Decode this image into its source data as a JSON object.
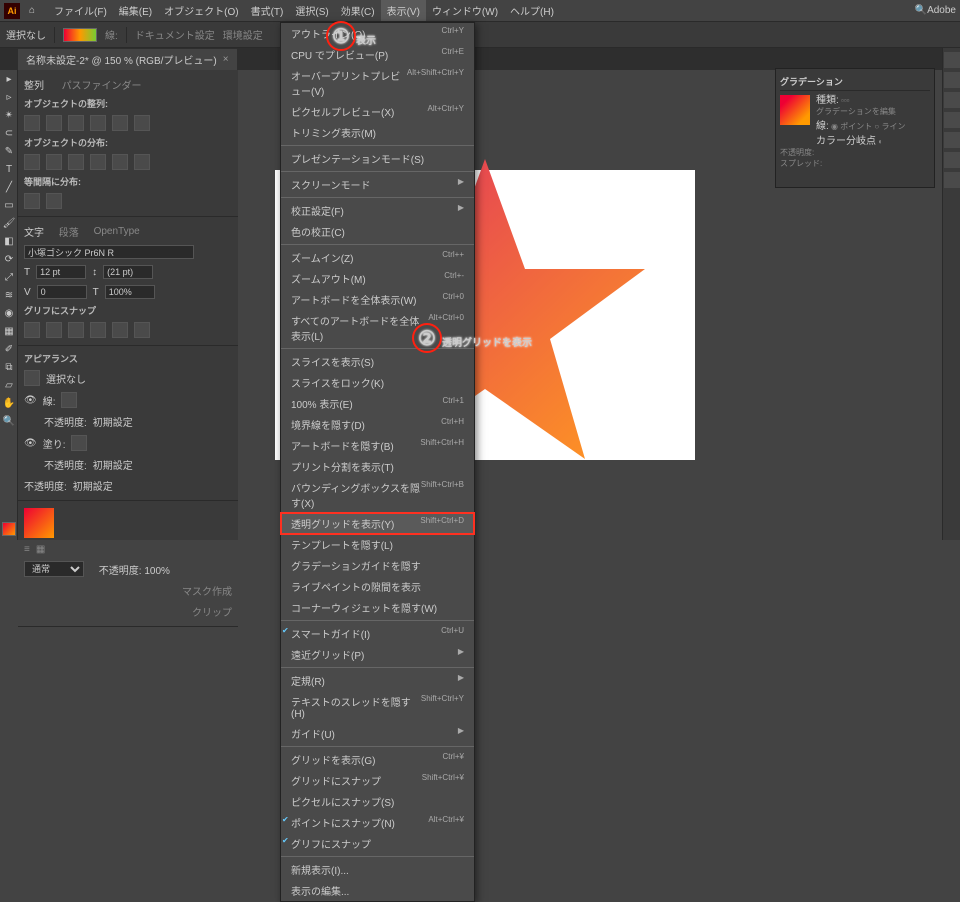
{
  "menubar": {
    "items": [
      "ファイル(F)",
      "編集(E)",
      "オブジェクト(O)",
      "書式(T)",
      "選択(S)",
      "効果(C)",
      "表示(V)",
      "ウィンドウ(W)",
      "ヘルプ(H)"
    ],
    "active_index": 6,
    "search_placeholder": "Adobe"
  },
  "ctrlbar": {
    "sel": "選択なし",
    "stroke": "線:",
    "doc_setup": "ドキュメント設定",
    "pref": "環境設定"
  },
  "doctab": {
    "title": "名称未設定-2* @ 150 % (RGB/プレビュー)",
    "close": "×"
  },
  "left": {
    "tabs": [
      "整列",
      "パスファインダー"
    ],
    "h_align": "オブジェクトの整列:",
    "h_dist": "オブジェクトの分布:",
    "h_spacing": "等間隔に分布:",
    "char_tabs": [
      "文字",
      "段落",
      "OpenType"
    ],
    "font": "小塚ゴシック Pr6N R",
    "size": "12 pt",
    "leading": "(21 pt)",
    "tracking": "0",
    "kerning": "100%",
    "vscale": "100%",
    "gsnap": "グリフにスナップ",
    "appear": "アピアランス",
    "nosel": "選択なし",
    "stroke": "線:",
    "fill": "塗り:",
    "opacity_lbl": "不透明度:",
    "opacity_val": "初期設定",
    "mode": "通常",
    "op100": "不透明度: 100%",
    "mask": "マスク作成",
    "clip": "クリップ"
  },
  "grad": {
    "title": "グラデーション",
    "type": "種類:",
    "edit": "グラデーションを編集",
    "stroke": "線:",
    "angle": "カラー分岐点",
    "op": "不透明度:",
    "spread": "スプレッド:"
  },
  "view_menu": [
    {
      "l": "アウトライン(O)",
      "s": "Ctrl+Y"
    },
    {
      "l": "CPU でプレビュー(P)",
      "s": "Ctrl+E"
    },
    {
      "l": "オーバープリントプレビュー(V)",
      "s": "Alt+Shift+Ctrl+Y"
    },
    {
      "l": "ピクセルプレビュー(X)",
      "s": "Alt+Ctrl+Y"
    },
    {
      "l": "トリミング表示(M)",
      "s": ""
    },
    {
      "hr": true
    },
    {
      "l": "プレゼンテーションモード(S)",
      "s": ""
    },
    {
      "hr": true
    },
    {
      "l": "スクリーンモード",
      "s": "",
      "sub": true
    },
    {
      "hr": true
    },
    {
      "l": "校正設定(F)",
      "s": "",
      "sub": true
    },
    {
      "l": "色の校正(C)",
      "s": ""
    },
    {
      "hr": true
    },
    {
      "l": "ズームイン(Z)",
      "s": "Ctrl++"
    },
    {
      "l": "ズームアウト(M)",
      "s": "Ctrl+-"
    },
    {
      "l": "アートボードを全体表示(W)",
      "s": "Ctrl+0"
    },
    {
      "l": "すべてのアートボードを全体表示(L)",
      "s": "Alt+Ctrl+0"
    },
    {
      "hr": true
    },
    {
      "l": "スライスを表示(S)",
      "s": ""
    },
    {
      "l": "スライスをロック(K)",
      "s": ""
    },
    {
      "l": "100% 表示(E)",
      "s": "Ctrl+1"
    },
    {
      "l": "境界線を隠す(D)",
      "s": "Ctrl+H"
    },
    {
      "l": "アートボードを隠す(B)",
      "s": "Shift+Ctrl+H"
    },
    {
      "l": "プリント分割を表示(T)",
      "s": ""
    },
    {
      "l": "バウンディングボックスを隠す(X)",
      "s": "Shift+Ctrl+B"
    },
    {
      "l": "透明グリッドを表示(Y)",
      "s": "Shift+Ctrl+D",
      "hl": true
    },
    {
      "l": "テンプレートを隠す(L)",
      "s": "",
      "dis": true
    },
    {
      "l": "グラデーションガイドを隠す",
      "s": "",
      "dis": true
    },
    {
      "l": "ライブペイントの隙間を表示",
      "s": "",
      "dis": true
    },
    {
      "l": "コーナーウィジェットを隠す(W)",
      "s": ""
    },
    {
      "hr": true
    },
    {
      "l": "スマートガイド(I)",
      "s": "Ctrl+U",
      "chk": true
    },
    {
      "l": "遠近グリッド(P)",
      "s": "",
      "sub": true
    },
    {
      "hr": true
    },
    {
      "l": "定規(R)",
      "s": "",
      "sub": true
    },
    {
      "l": "テキストのスレッドを隠す(H)",
      "s": "Shift+Ctrl+Y"
    },
    {
      "l": "ガイド(U)",
      "s": "",
      "sub": true
    },
    {
      "hr": true
    },
    {
      "l": "グリッドを表示(G)",
      "s": "Ctrl+¥"
    },
    {
      "l": "グリッドにスナップ",
      "s": "Shift+Ctrl+¥"
    },
    {
      "l": "ピクセルにスナップ(S)",
      "s": ""
    },
    {
      "l": "ポイントにスナップ(N)",
      "s": "Alt+Ctrl+¥",
      "chk": true
    },
    {
      "l": "グリフにスナップ",
      "s": "",
      "chk": true
    },
    {
      "hr": true
    },
    {
      "l": "新規表示(I)...",
      "s": ""
    },
    {
      "l": "表示の編集...",
      "s": ""
    }
  ],
  "callouts": {
    "c1": "①",
    "t1": "表示",
    "c2": "②",
    "t2": "透明グリッドを表示"
  }
}
